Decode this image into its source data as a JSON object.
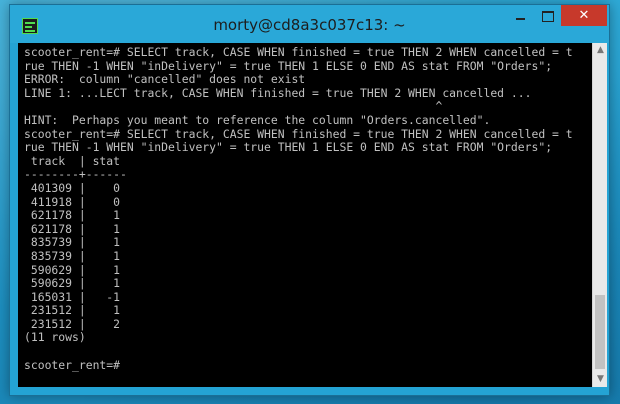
{
  "window": {
    "title": "morty@cd8a3c037c13: ~",
    "app_icon": "terminal-app-icon",
    "minimize_icon": "minimize-icon",
    "maximize_icon": "maximize-icon",
    "close_symbol": "✕",
    "close_color": "#c7392b"
  },
  "terminal": {
    "lines": [
      "scooter_rent=# SELECT track, CASE WHEN finished = true THEN 2 WHEN cancelled = t",
      "rue THEN -1 WHEN \"inDelivery\" = true THEN 1 ELSE 0 END AS stat FROM \"Orders\";",
      "ERROR:  column \"cancelled\" does not exist",
      "LINE 1: ...LECT track, CASE WHEN finished = true THEN 2 WHEN cancelled ...",
      "                                                            ^",
      "HINT:  Perhaps you meant to reference the column \"Orders.cancelled\".",
      "scooter_rent=# SELECT track, CASE WHEN finished = true THEN 2 WHEN cancelled = t",
      "rue THEN -1 WHEN \"inDelivery\" = true THEN 1 ELSE 0 END AS stat FROM \"Orders\";",
      " track  | stat",
      "--------+------",
      " 401309 |    0",
      " 411918 |    0",
      " 621178 |    1",
      " 621178 |    1",
      " 835739 |    1",
      " 835739 |    1",
      " 590629 |    1",
      " 590629 |    1",
      " 165031 |   -1",
      " 231512 |    1",
      " 231512 |    2",
      "(11 rows)",
      "",
      "scooter_rent=# "
    ]
  },
  "scrollbar": {
    "up_arrow": "▲",
    "down_arrow": "▼"
  }
}
